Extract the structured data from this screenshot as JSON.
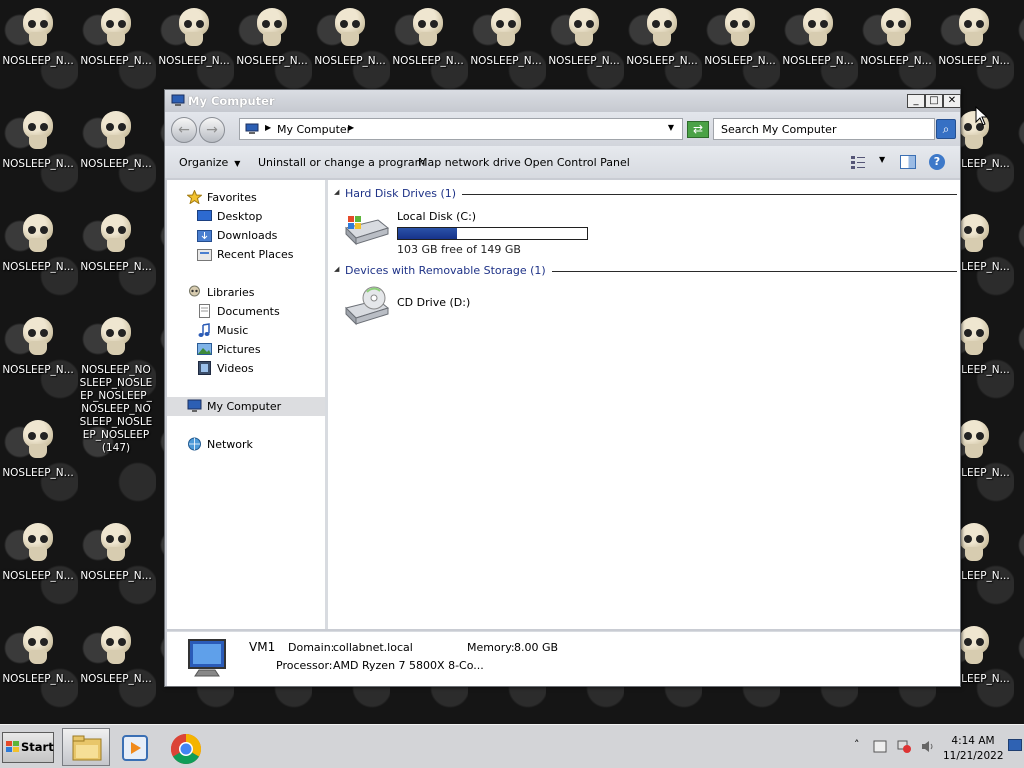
{
  "desktop": {
    "icon_label_short": "NOSLEEP_N...",
    "first_icon_label": "NOSLEEP_N...",
    "long_icon_label": "NOSLEEP_NOSLEEP_NOSLEEP_NOSLEEP_NOSLEEP_NOSLEEP_NOSLEEP_NOSLEEP(147)"
  },
  "window": {
    "title": "My Computer",
    "controls": {
      "minimize": "_",
      "maximize": "□",
      "close": "✕"
    },
    "address": {
      "crumb": "My Computer"
    },
    "search": {
      "placeholder": "Search My Computer"
    },
    "toolbar": {
      "organize": "Organize",
      "uninstall": "Uninstall or change a program",
      "map_drive": "Map network drive",
      "control_panel": "Open Control Panel",
      "help": "?"
    },
    "nav": {
      "favorites": "Favorites",
      "desktop": "Desktop",
      "downloads": "Downloads",
      "recent": "Recent Places",
      "libraries": "Libraries",
      "documents": "Documents",
      "music": "Music",
      "pictures": "Pictures",
      "videos": "Videos",
      "my_computer": "My Computer",
      "network": "Network"
    },
    "content": {
      "hdd_group": "Hard Disk Drives (1)",
      "removable_group": "Devices with Removable Storage (1)",
      "local_disk": {
        "name": "Local Disk (C:)",
        "free": "103 GB free of 149 GB",
        "used_fraction": 0.31
      },
      "cd_drive": {
        "name": "CD Drive (D:)"
      }
    },
    "details": {
      "name": "VM1",
      "domain_label": "Domain:",
      "domain": "collabnet.local",
      "memory_label": "Memory:",
      "memory": "8.00 GB",
      "processor_label": "Processor:",
      "processor": "AMD Ryzen 7 5800X 8-Co..."
    }
  },
  "taskbar": {
    "start": "Start",
    "time": "4:14 AM",
    "date": "11/21/2022"
  },
  "colors": {
    "title_text": "#ffffff",
    "group_header": "#1e3287",
    "disk_bar": "#17338a",
    "selected_nav": "#dcdde0"
  }
}
